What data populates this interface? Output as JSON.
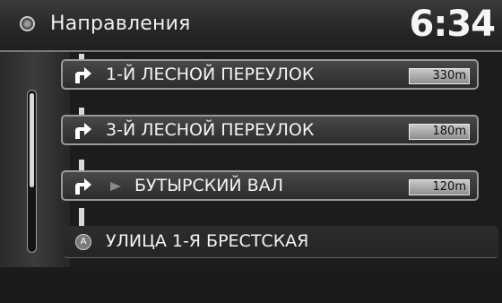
{
  "header": {
    "title": "Направления",
    "clock": "6:34"
  },
  "directions": [
    {
      "street": "1-Й ЛЕСНОЙ ПЕРЕУЛОК",
      "distance": "330m",
      "maneuver": "turn-right"
    },
    {
      "street": "3-Й ЛЕСНОЙ ПЕРЕУЛОК",
      "distance": "180m",
      "maneuver": "turn-right"
    },
    {
      "street": "БУТЫРСКИЙ ВАЛ",
      "distance": "120m",
      "maneuver": "turn-right"
    }
  ],
  "destination": {
    "street": "УЛИЦА 1-Я БРЕСТСКАЯ",
    "icon_letter": "A"
  },
  "scroll": {
    "position_fraction": 0.0,
    "visible_fraction": 0.58
  },
  "colors": {
    "background": "#1c1c1c",
    "row_border": "#9a9a9a",
    "badge": "#b0b0b0",
    "text": "#f2f2f2"
  }
}
